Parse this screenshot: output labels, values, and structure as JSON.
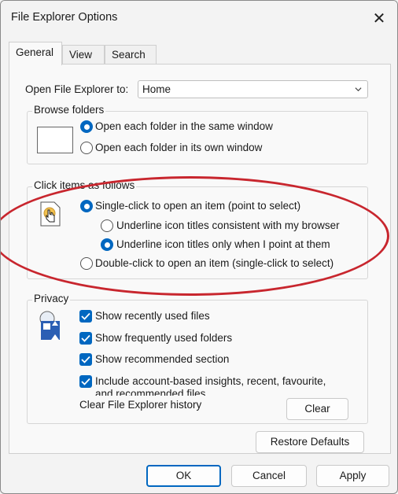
{
  "window": {
    "title": "File Explorer Options",
    "close_icon": "close-icon"
  },
  "tabs": [
    {
      "label": "General",
      "active": true
    },
    {
      "label": "View"
    },
    {
      "label": "Search"
    }
  ],
  "open_to": {
    "label": "Open File Explorer to:",
    "value": "Home"
  },
  "browse_folders": {
    "legend": "Browse folders",
    "options": [
      "Open each folder in the same window",
      "Open each folder in its own window"
    ],
    "selected": 0
  },
  "click_items": {
    "legend": "Click items as follows",
    "single_click": "Single-click to open an item (point to select)",
    "underline_consistent": "Underline icon titles consistent with my browser",
    "underline_point": "Underline icon titles only when I point at them",
    "double_click": "Double-click to open an item (single-click to select)"
  },
  "privacy": {
    "legend": "Privacy",
    "checks": [
      "Show recently used files",
      "Show frequently used folders",
      "Show recommended section",
      "Include account-based insights, recent, favourite,",
      "and recommended files"
    ],
    "clear_history_label": "Clear File Explorer history",
    "clear_button": "Clear"
  },
  "restore_defaults": "Restore Defaults",
  "footer": {
    "ok": "OK",
    "cancel": "Cancel",
    "apply": "Apply"
  },
  "colors": {
    "accent": "#0067c0",
    "highlight": "#c8262e"
  }
}
